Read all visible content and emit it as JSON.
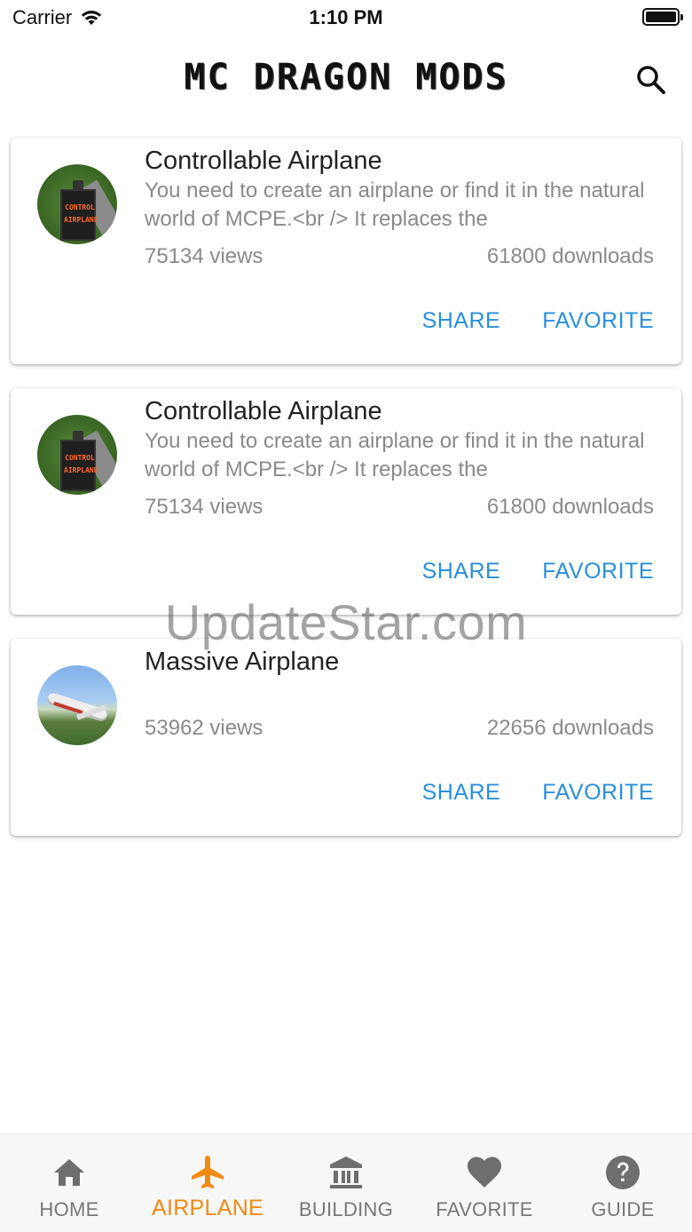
{
  "status_bar": {
    "carrier": "Carrier",
    "time": "1:10 PM"
  },
  "app_bar": {
    "title": "MC DRAGON MODS",
    "search_icon": "search-icon"
  },
  "cards": [
    {
      "title": "Controllable Airplane",
      "description": "You need to create an airplane or find it in the natural world of MCPE.<br /> It replaces the",
      "views": "75134 views",
      "downloads": "61800 downloads",
      "thumbnail_text": [
        "CONTROL",
        "AIRPLANE"
      ],
      "share_label": "SHARE",
      "favorite_label": "FAVORITE"
    },
    {
      "title": "Controllable Airplane",
      "description": "You need to create an airplane or find it in the natural world of MCPE.<br /> It replaces the",
      "views": "75134 views",
      "downloads": "61800 downloads",
      "thumbnail_text": [
        "CONTROL",
        "AIRPLANE"
      ],
      "share_label": "SHARE",
      "favorite_label": "FAVORITE"
    },
    {
      "title": "Massive Airplane",
      "description": "",
      "views": "53962 views",
      "downloads": "22656 downloads",
      "share_label": "SHARE",
      "favorite_label": "FAVORITE"
    }
  ],
  "watermark": "UpdateStar.com",
  "bottom_nav": {
    "items": [
      {
        "label": "HOME",
        "icon": "home-icon",
        "active": false
      },
      {
        "label": "AIRPLANE",
        "icon": "airplane-icon",
        "active": true
      },
      {
        "label": "BUILDING",
        "icon": "bank-icon",
        "active": false
      },
      {
        "label": "FAVORITE",
        "icon": "heart-icon",
        "active": false
      },
      {
        "label": "GUIDE",
        "icon": "help-circle-icon",
        "active": false
      }
    ]
  },
  "colors": {
    "accent_blue": "#2a8fde",
    "active_orange": "#f08a13",
    "inactive_gray": "#777777",
    "secondary_text": "#8a8a8a"
  }
}
